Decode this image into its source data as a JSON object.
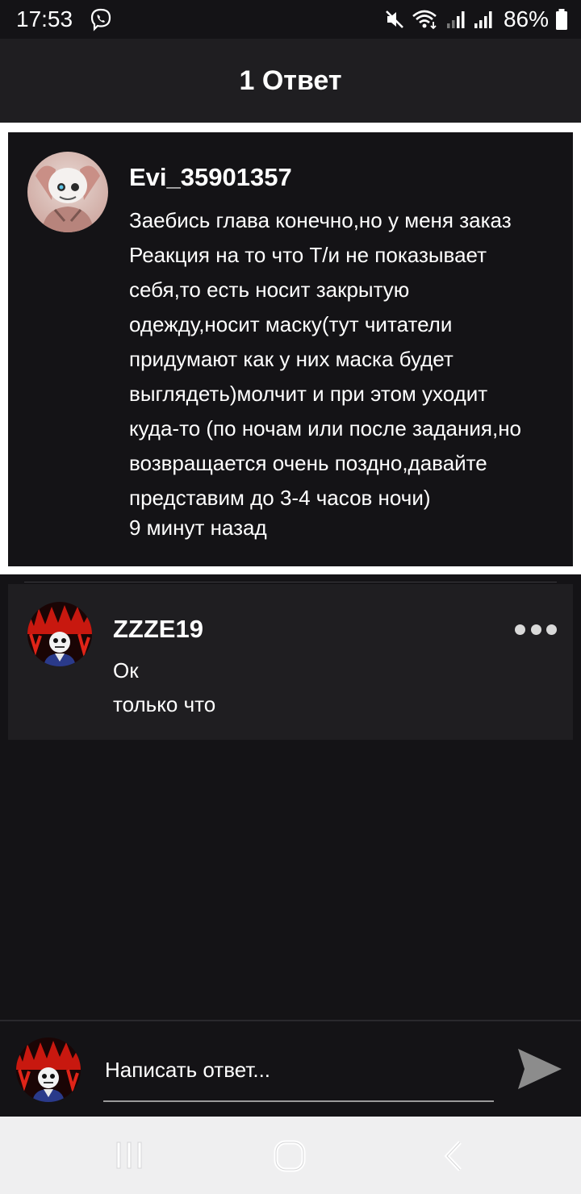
{
  "status_bar": {
    "time": "17:53",
    "battery": "86%",
    "icons": [
      "viber-icon",
      "mute-icon",
      "wifi-icon",
      "signal-icon",
      "signal-icon",
      "battery-icon"
    ]
  },
  "header": {
    "title": "1 Ответ"
  },
  "parent_comment": {
    "username": "Evi_35901357",
    "text": "Заебись глава конечно,но у меня заказ\nРеакция на то что Т/и не показывает\nсебя,то есть носит закрытую\nодежду,носит маску(тут читатели\nпридумают как у них маска будет\nвыглядеть)молчит и при этом уходит\nкуда-то (по ночам или после задания,но\nвозвращается очень поздно,давайте\nпредставим до 3-4 часов ночи)",
    "time": "9 минут назад"
  },
  "reply": {
    "username": "ZZZE19",
    "text": "Ок",
    "time": "только что"
  },
  "compose": {
    "placeholder": "Написать ответ..."
  },
  "colors": {
    "background": "#141316",
    "header": "#1f1e21",
    "reply_card": "#1f1e21",
    "send_icon": "#8c8c8c"
  }
}
